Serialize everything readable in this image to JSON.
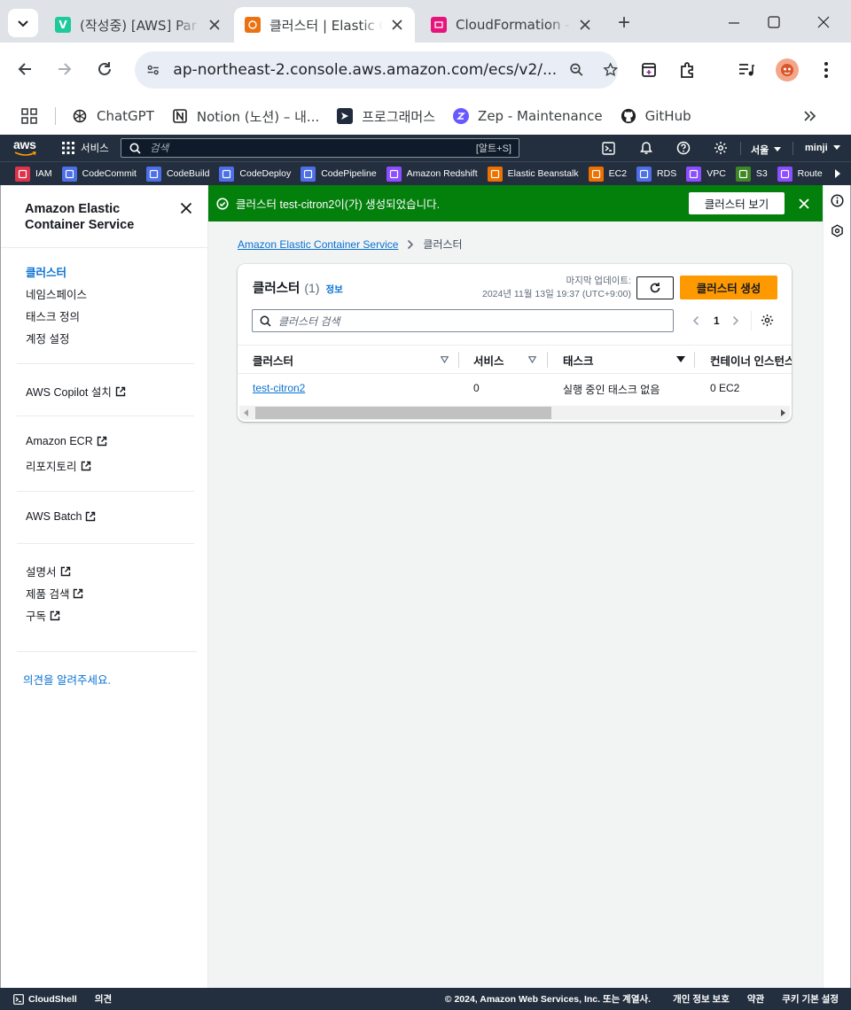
{
  "browser": {
    "tabs": [
      {
        "title": "(작성중) [AWS] Par",
        "favicon_color": "#1ec99a",
        "favicon_letter": "V"
      },
      {
        "title": "클러스터 | Elastic C",
        "favicon_color": "#ec7211",
        "active": true
      },
      {
        "title": "CloudFormation - ",
        "favicon_color": "#e7157b"
      }
    ],
    "new_tab_symbol": "+",
    "url": "ap-northeast-2.console.aws.amazon.com/ecs/v2/...",
    "bookmarks": [
      {
        "label": "ChatGPT",
        "icon": "openai-icon"
      },
      {
        "label": "Notion (노션) – 내...",
        "icon": "notion-icon"
      },
      {
        "label": "프로그래머스",
        "icon": "programmers-icon"
      },
      {
        "label": "Zep - Maintenance",
        "icon": "zep-icon"
      },
      {
        "label": "GitHub",
        "icon": "github-icon"
      }
    ]
  },
  "aws_nav": {
    "logo": "aws",
    "services_label": "서비스",
    "search_placeholder": "검색",
    "search_shortcut": "[알트+S]",
    "region": "서울",
    "user": "minji",
    "services": [
      {
        "label": "IAM",
        "color": "#dd344c"
      },
      {
        "label": "CodeCommit",
        "color": "#4d6fe8"
      },
      {
        "label": "CodeBuild",
        "color": "#4d6fe8"
      },
      {
        "label": "CodeDeploy",
        "color": "#4d6fe8"
      },
      {
        "label": "CodePipeline",
        "color": "#4d6fe8"
      },
      {
        "label": "Amazon Redshift",
        "color": "#8c4fff"
      },
      {
        "label": "Elastic Beanstalk",
        "color": "#ed7100"
      },
      {
        "label": "EC2",
        "color": "#ed7100"
      },
      {
        "label": "RDS",
        "color": "#4d6fe8"
      },
      {
        "label": "VPC",
        "color": "#8c4fff"
      },
      {
        "label": "S3",
        "color": "#3f8624"
      },
      {
        "label": "Route",
        "color": "#8c4fff"
      }
    ]
  },
  "sidenav": {
    "title_line1": "Amazon Elastic",
    "title_line2": "Container Service",
    "items": [
      "클러스터",
      "네임스페이스",
      "태스크 정의",
      "계정 설정"
    ],
    "copilot": "AWS Copilot 설치",
    "ecr": "Amazon ECR",
    "repo": "리포지토리",
    "batch": "AWS Batch",
    "docs": "설명서",
    "product_search": "제품 검색",
    "subscribe": "구독",
    "feedback": "의견을 알려주세요."
  },
  "flash": {
    "message": "클러스터 test-citron2이(가) 생성되었습니다.",
    "action": "클러스터 보기"
  },
  "breadcrumb": {
    "root": "Amazon Elastic Container Service",
    "current": "클러스터"
  },
  "panel": {
    "title": "클러스터",
    "count": "(1)",
    "info": "정보",
    "last_updated_label": "마지막 업데이트:",
    "last_updated_value": "2024년 11월 13일 19:37 (UTC+9:00)",
    "create_button": "클러스터 생성",
    "search_placeholder": "클러스터 검색",
    "page": "1",
    "columns": [
      "클러스터",
      "서비스",
      "태스크",
      "컨테이너 인스턴스"
    ],
    "rows": [
      {
        "cluster": "test-citron2",
        "services": "0",
        "tasks": "실행 중인 태스크 없음",
        "instances": "0 EC2"
      }
    ]
  },
  "footer": {
    "cloudshell": "CloudShell",
    "feedback": "의견",
    "copyright": "© 2024, Amazon Web Services, Inc. 또는 계열사.",
    "privacy": "개인 정보 보호",
    "terms": "약관",
    "cookies": "쿠키 기본 설정"
  }
}
